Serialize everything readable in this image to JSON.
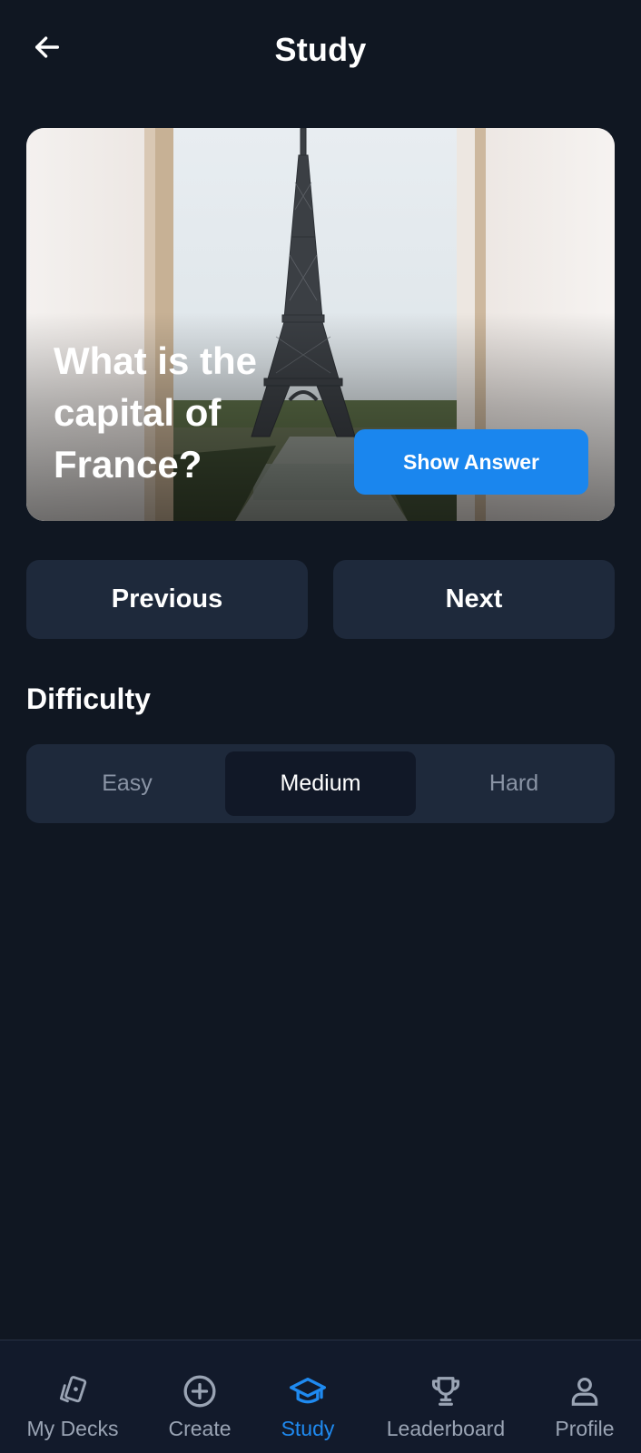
{
  "header": {
    "title": "Study",
    "back_icon": "arrow-left-icon"
  },
  "card": {
    "image": "eiffel-tower-photo",
    "question": "What is the capital of France?",
    "show_answer_label": "Show Answer"
  },
  "navigation": {
    "previous_label": "Previous",
    "next_label": "Next"
  },
  "difficulty": {
    "title": "Difficulty",
    "options": [
      "Easy",
      "Medium",
      "Hard"
    ],
    "selected": "Medium"
  },
  "bottom_nav": {
    "items": [
      {
        "label": "My Decks",
        "icon": "cards-icon"
      },
      {
        "label": "Create",
        "icon": "plus-circle-icon"
      },
      {
        "label": "Study",
        "icon": "graduation-cap-icon"
      },
      {
        "label": "Leaderboard",
        "icon": "trophy-icon"
      },
      {
        "label": "Profile",
        "icon": "person-icon"
      }
    ],
    "active": "Study"
  },
  "colors": {
    "background": "#101722",
    "surface": "#1e293b",
    "accent": "#1a86ee",
    "muted_text": "#8a94a5"
  }
}
